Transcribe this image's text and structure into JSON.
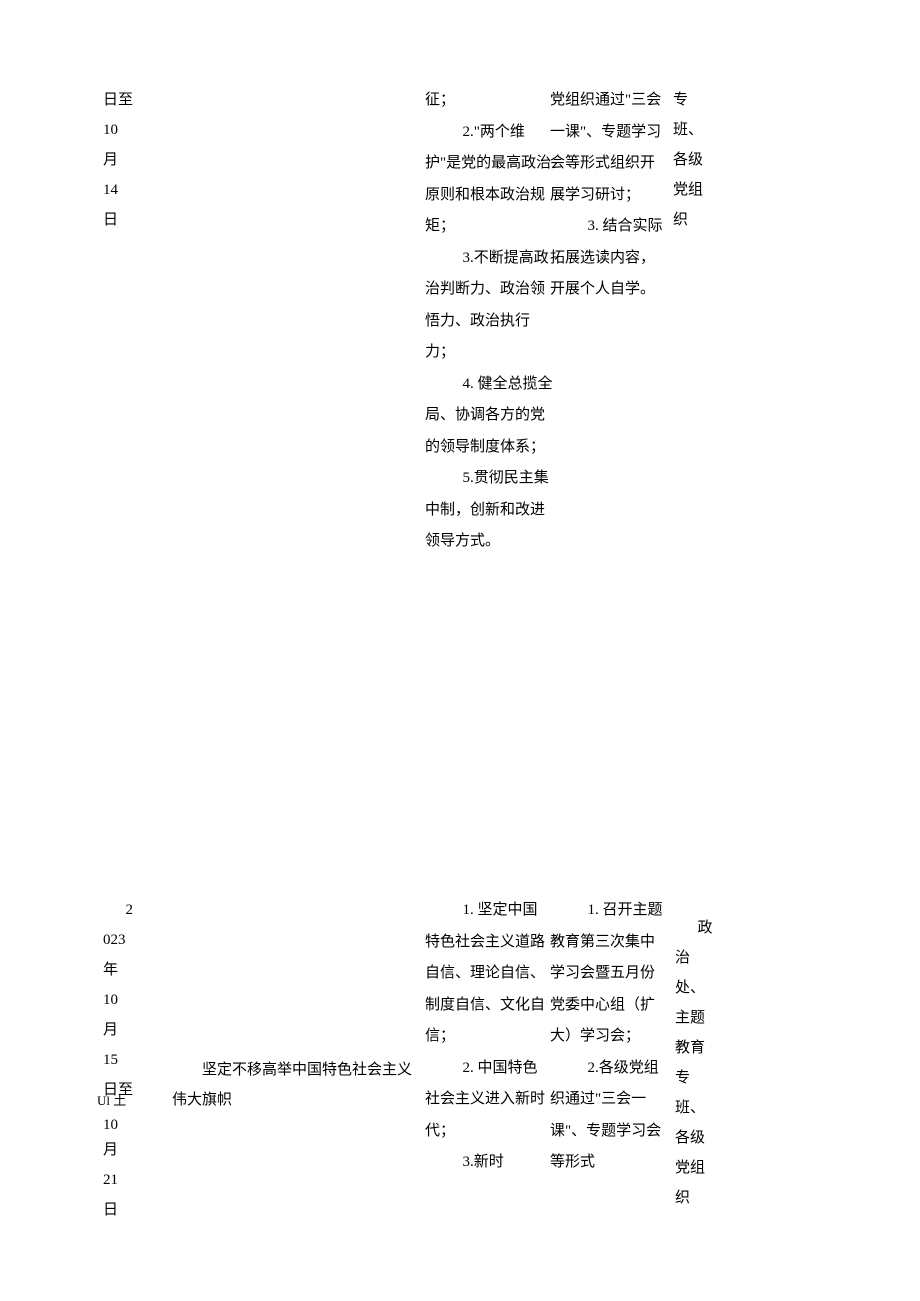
{
  "row1": {
    "date": [
      "日至",
      "10",
      "月",
      "14",
      "日"
    ],
    "content": [
      "征；",
      "2.\"两个维护\"是党的最高政治原则和根本政治规矩；",
      "3.不断提高政治判断力、政治领悟力、政治执行力；",
      "4. 健全总揽全局、协调各方的党的领导制度体系；",
      "5.贯彻民主集中制，创新和改进领导方式。"
    ],
    "method": [
      "党组织通过\"三会一课\"、专题学习会等形式组织开展学习研讨；",
      "3. 结合实际拓展选读内容，开展个人自学。"
    ],
    "dept": [
      "专",
      "班、",
      "各级",
      "党组",
      "织"
    ]
  },
  "row2": {
    "date": [
      "2",
      "023",
      "年",
      "10",
      "月",
      "15",
      "日至",
      "10",
      "月",
      "21",
      "日"
    ],
    "date_special": "Ul 土",
    "topic": "坚定不移高举中国特色社会主义伟大旗帜",
    "content": [
      "1. 坚定中国特色社会主义道路自信、理论自信、制度自信、文化自信；",
      "2. 中国特色社会主义进入新时代；",
      "3.新时"
    ],
    "method": [
      "1. 召开主题教育第三次集中学习会暨五月份党委中心组（扩大）学习会；",
      "2.各级党组织通过\"三会一课\"、专题学习会等形式"
    ],
    "dept": [
      "政",
      "治",
      "处、",
      "主题",
      "教育",
      "专",
      "班、",
      "各级",
      "党组",
      "织"
    ]
  }
}
